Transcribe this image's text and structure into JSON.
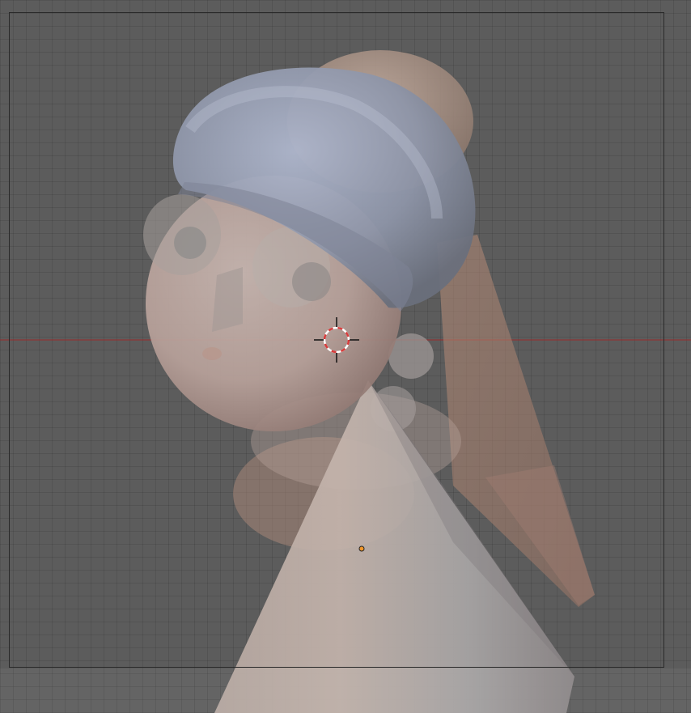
{
  "viewport": {
    "view": "camera",
    "shading": "solid",
    "xray": true,
    "colors": {
      "background": "#5c5c5c",
      "grid_line": "#525252",
      "x_axis": "#9b2b2b",
      "frame_border": "#2a2a2a",
      "cursor_red": "#d83b3b",
      "cursor_white": "#ffffff",
      "origin": "#f0962a"
    },
    "objects": [
      {
        "name": "head",
        "icon": "sphere-icon"
      },
      {
        "name": "turban",
        "icon": "torus-icon"
      },
      {
        "name": "turban-top",
        "icon": "sphere-icon"
      },
      {
        "name": "body",
        "icon": "cone-icon"
      },
      {
        "name": "veil",
        "icon": "plane-icon"
      },
      {
        "name": "earring",
        "icon": "sphere-icon"
      }
    ],
    "cursor": "3d-cursor-icon",
    "origin_marker": "object-origin-icon"
  }
}
